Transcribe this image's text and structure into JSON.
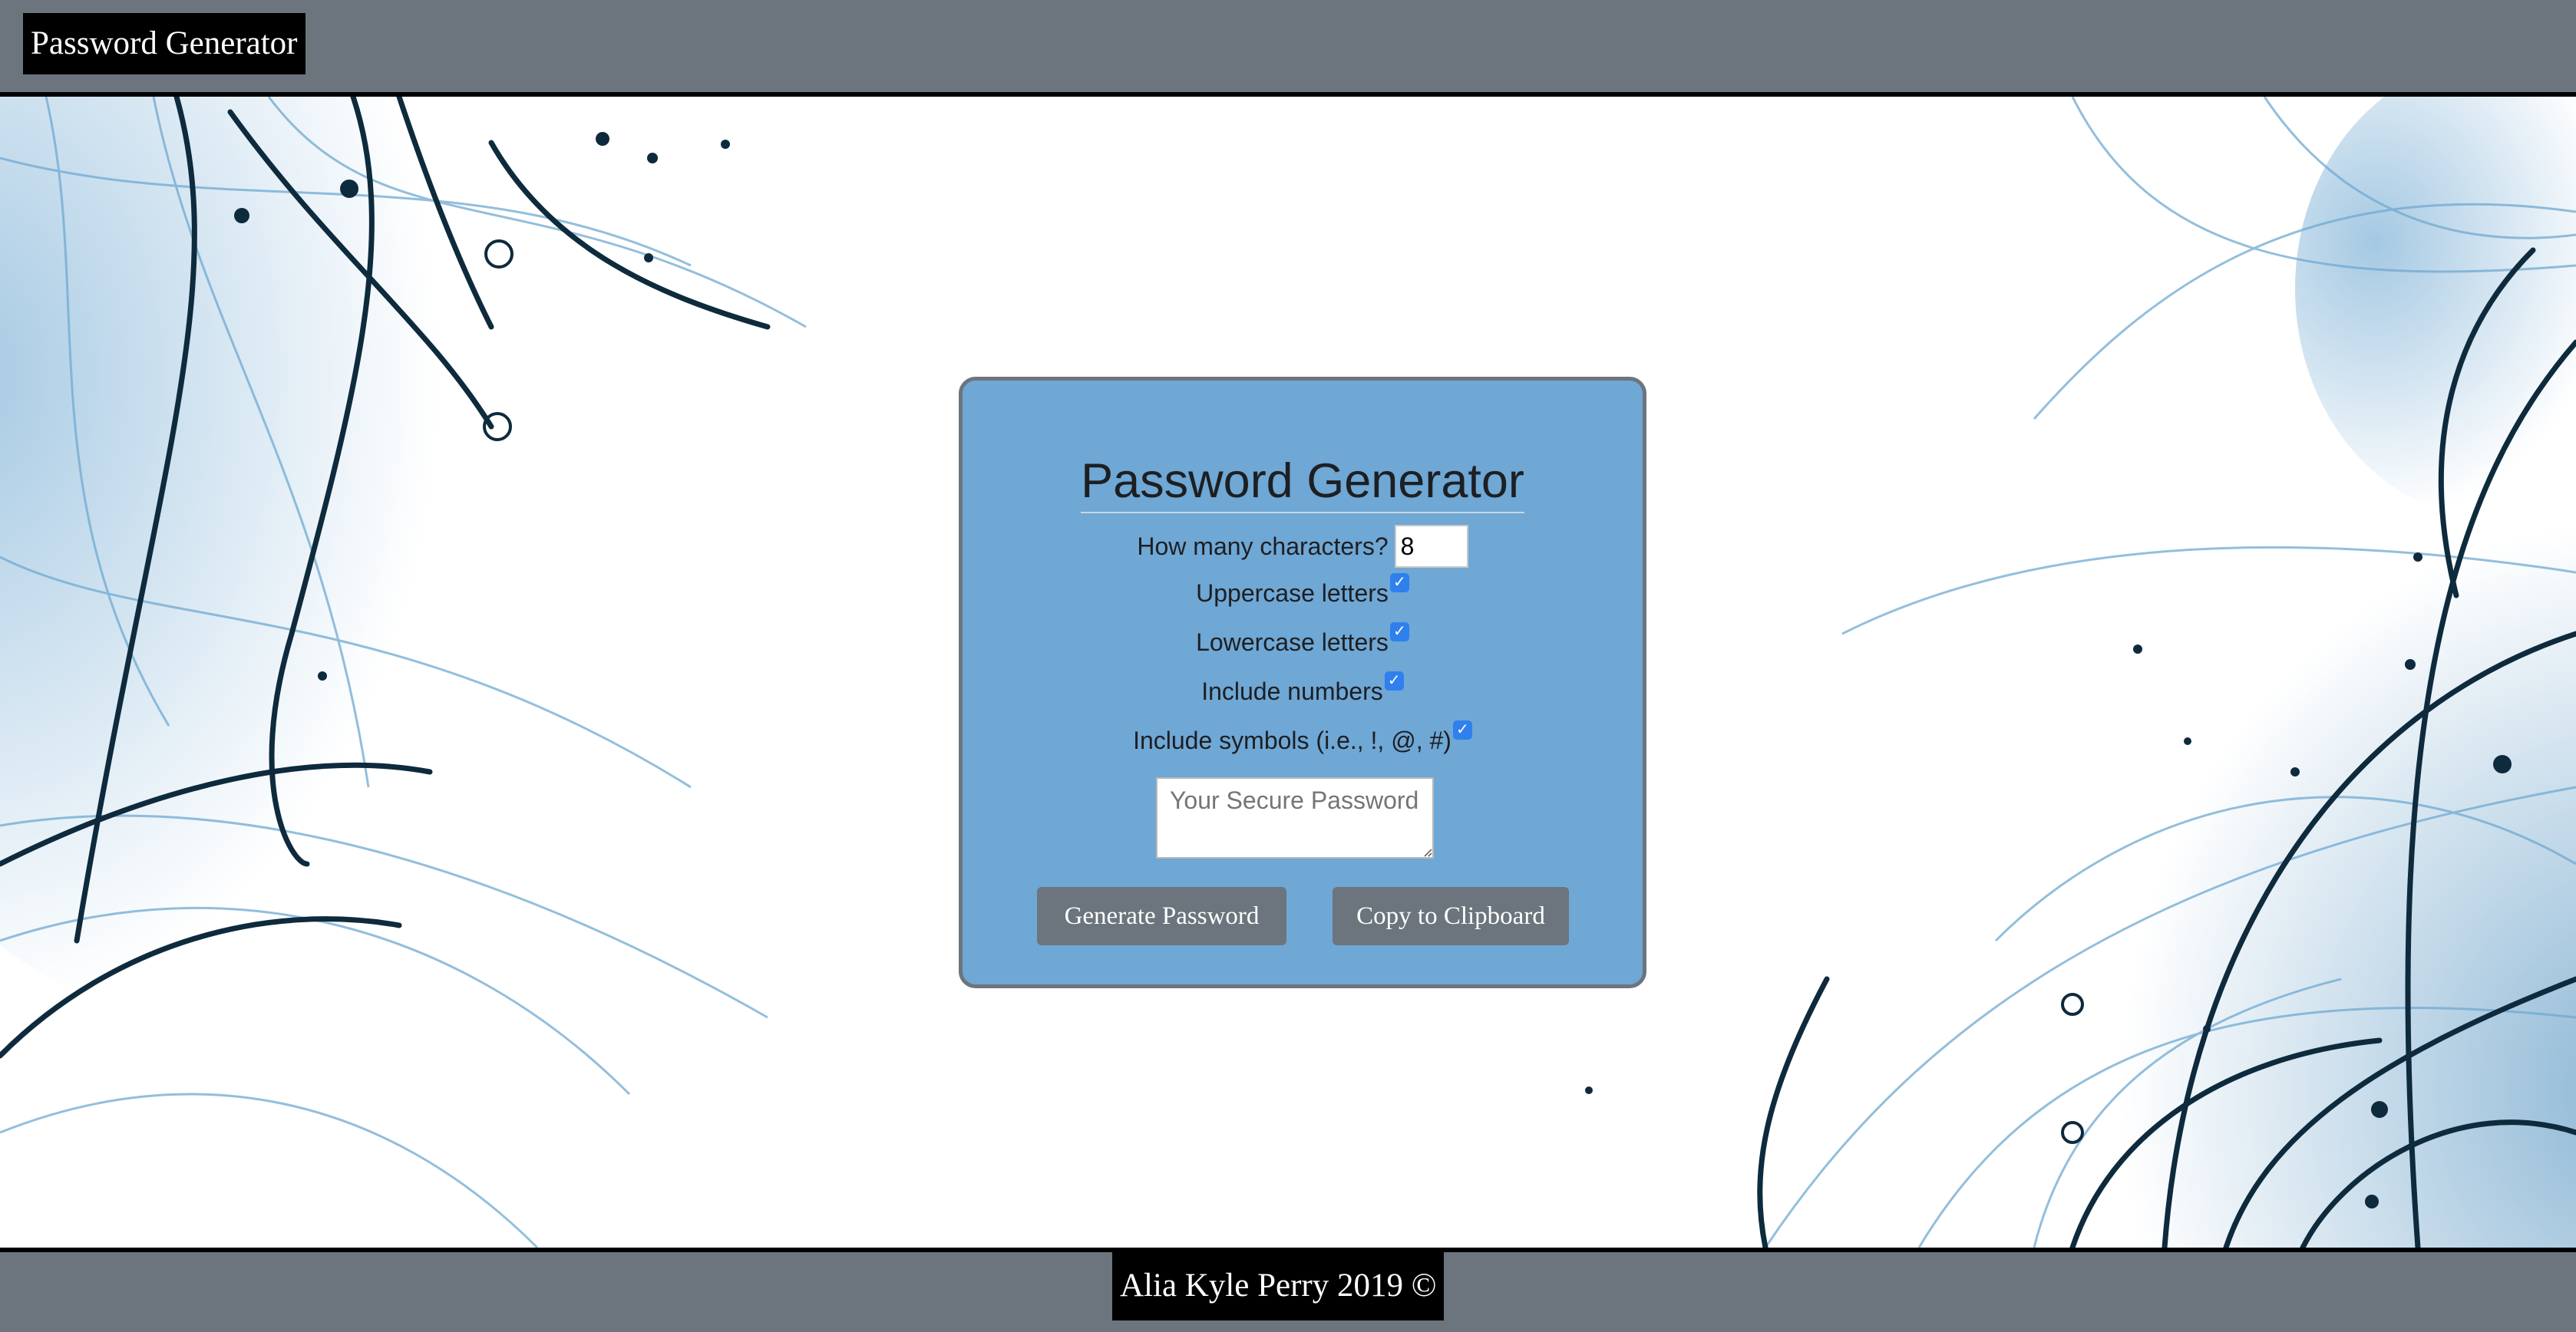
{
  "navbar": {
    "brand": "Password Generator"
  },
  "card": {
    "title": "Password Generator",
    "length_label": "How many characters?",
    "length_value": "8",
    "options": [
      {
        "label": "Uppercase letters",
        "checked": true
      },
      {
        "label": "Lowercase letters",
        "checked": true
      },
      {
        "label": "Include numbers",
        "checked": true
      },
      {
        "label": "Include symbols (i.e., !, @, #)",
        "checked": true
      }
    ],
    "password_placeholder": "Your Secure Password",
    "generate_label": "Generate Password",
    "copy_label": "Copy to Clipboard"
  },
  "footer": {
    "credit": "Alia Kyle Perry 2019 ©"
  },
  "colors": {
    "bar": "#6c757d",
    "card": "#6fa7d5",
    "checkbox": "#2f80ed",
    "ink": "#0e2a3d",
    "wisp": "#3f86b8"
  },
  "icons": {
    "checkbox": "check-icon",
    "resize": "resize-grip-icon"
  }
}
